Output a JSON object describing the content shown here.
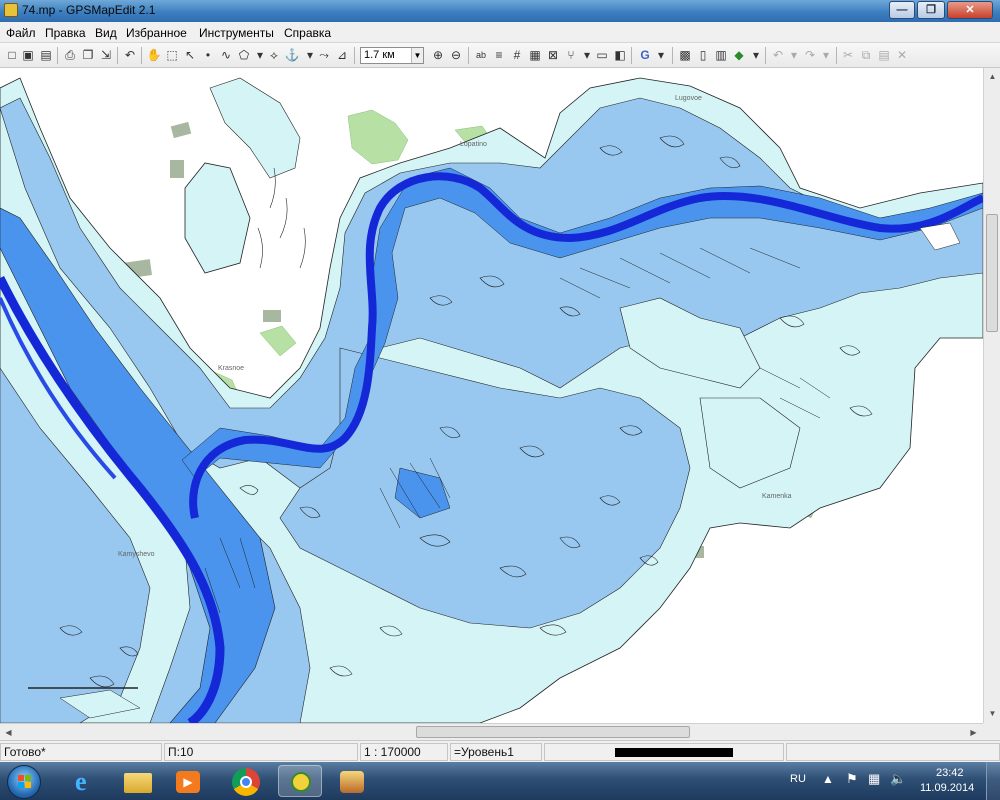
{
  "window": {
    "title": "74.mp - GPSMapEdit 2.1",
    "minimize_label": "—",
    "maximize_label": "❐",
    "close_label": "✕"
  },
  "menu": {
    "items": [
      "Файл",
      "Правка",
      "Вид",
      "Избранное",
      "Инструменты",
      "Справка"
    ]
  },
  "toolbar": {
    "zoom_value": "1.7 км",
    "icons": [
      "new-file-icon",
      "save-icon",
      "open-icon",
      "print-icon",
      "undo-icon",
      "hand-pan-icon",
      "zoom-select-icon",
      "add-point-icon",
      "add-line-icon",
      "add-polygon-icon",
      "node-edit-icon",
      "measure-icon",
      "zoom-in-icon",
      "zoom-out-icon",
      "label-icon",
      "grid-icon",
      "google-icon",
      "layers-icon"
    ]
  },
  "map": {
    "labels": [
      "Kamyshevo",
      "Krasnoe",
      "Kamenka",
      "Lopatino",
      "Lugovoe"
    ],
    "colors": {
      "land": "#ffffff",
      "vegetation": "#b6e0a4",
      "settlement": "#a8b8a0",
      "shallow": "#d4f4f6",
      "medium": "#98c8f0",
      "deep": "#4a94ee",
      "channel": "#1428d8"
    }
  },
  "status": {
    "ready": "Готово*",
    "level_code": "П:10",
    "scale": "1 : 170000",
    "level": "=Уровень1"
  },
  "taskbar": {
    "apps": [
      "start-orb",
      "internet-explorer-icon",
      "file-explorer-icon",
      "media-player-icon",
      "chrome-icon",
      "gpsmapedit-icon",
      "app-icon"
    ],
    "language": "RU",
    "time": "23:42",
    "date": "11.09.2014"
  }
}
